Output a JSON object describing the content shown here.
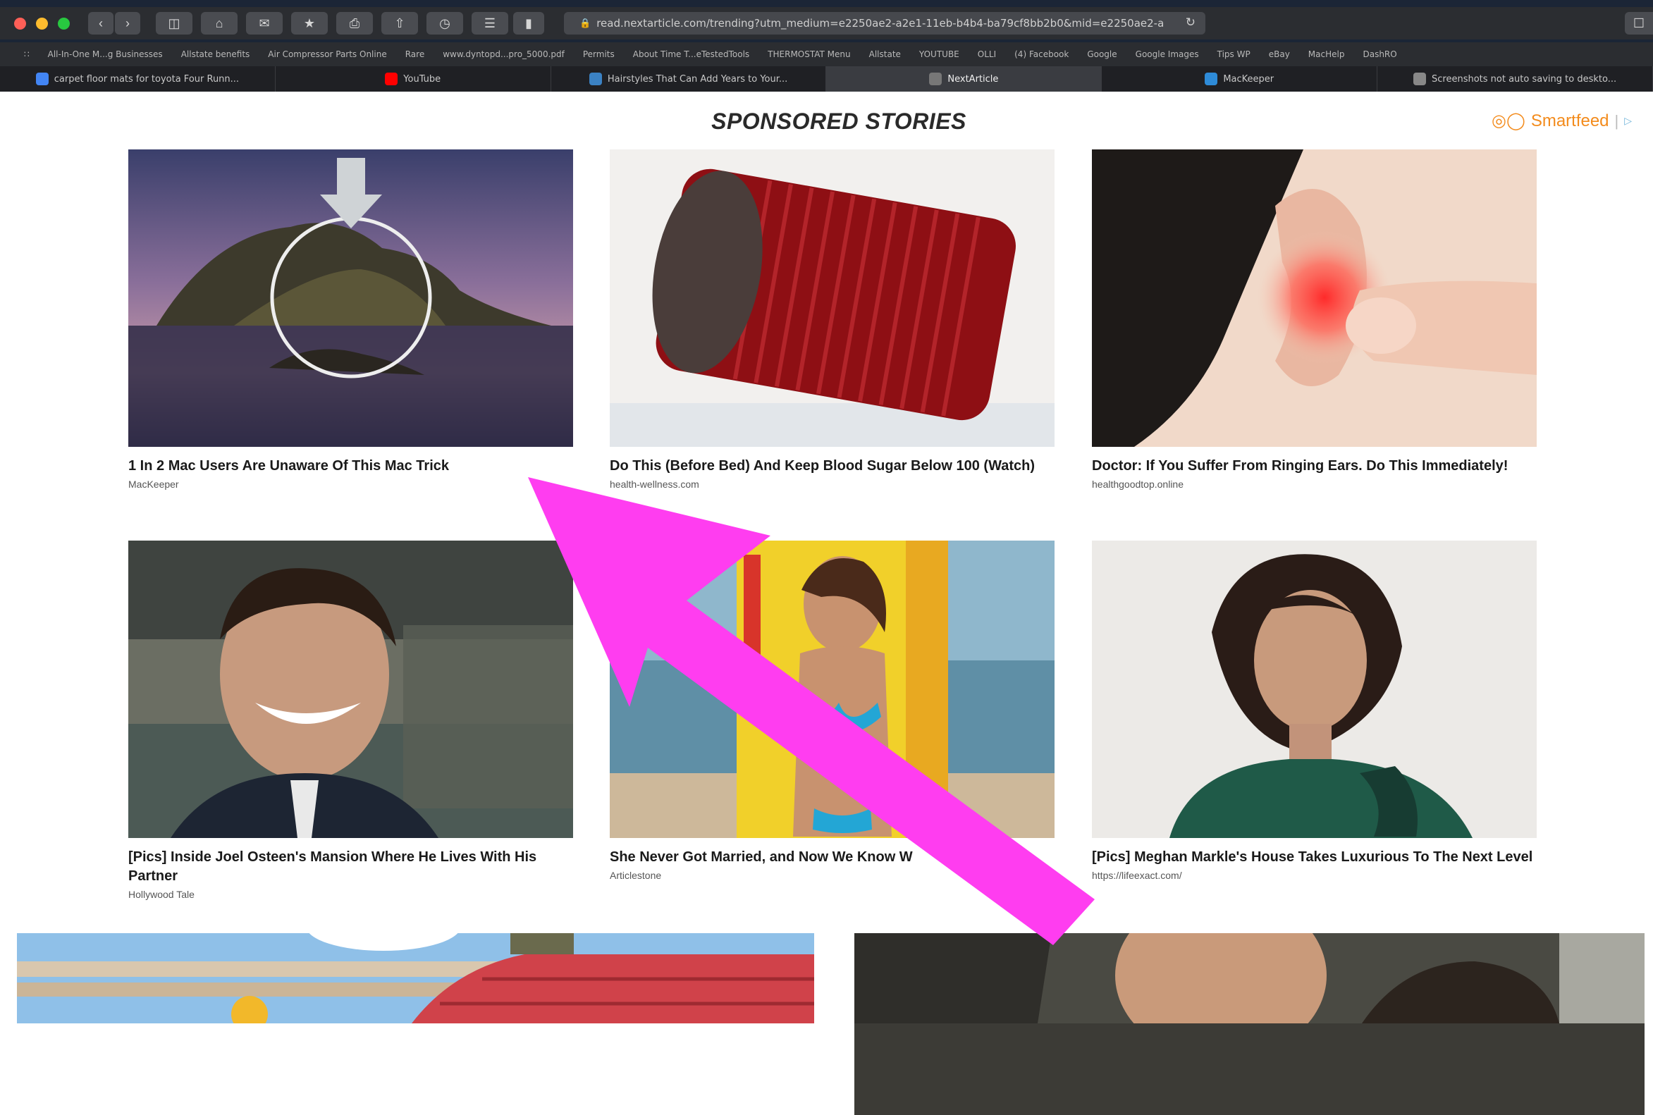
{
  "browser": {
    "url": "read.nextarticle.com/trending?utm_medium=e2250ae2-a2e1-11eb-b4b4-ba79cf8bb2b0&mid=e2250ae2-a",
    "bookmarks": [
      "All-In-One M...g Businesses",
      "Allstate benefits",
      "Air Compressor Parts Online",
      "Rare",
      "www.dyntopd...pro_5000.pdf",
      "Permits",
      "About Time T...eTestedTools",
      "THERMOSTAT Menu",
      "Allstate",
      "YOUTUBE",
      "OLLI",
      "(4) Facebook",
      "Google",
      "Google Images",
      "Tips WP",
      "eBay",
      "MacHelp",
      "DashRO"
    ],
    "tabs": [
      {
        "label": "carpet floor mats for toyota Four Runn...",
        "icon": "google-icon",
        "color": "#4285f4"
      },
      {
        "label": "YouTube",
        "icon": "youtube-icon",
        "color": "#ff0000"
      },
      {
        "label": "Hairstyles That Can Add Years to Your...",
        "icon": "f-icon",
        "color": "#3b82c4"
      },
      {
        "label": "NextArticle",
        "icon": "n-icon",
        "color": "#777777",
        "active": true
      },
      {
        "label": "MacKeeper",
        "icon": "mackeeper-icon",
        "color": "#2e8bd8"
      },
      {
        "label": "Screenshots not auto saving to deskto...",
        "icon": "apple-icon",
        "color": "#888888"
      }
    ]
  },
  "page": {
    "heading": "SPONSORED STORIES",
    "brand": "Smartfeed",
    "cards": [
      {
        "title": "1 In 2 Mac Users Are Unaware Of This Mac Trick",
        "source": "MacKeeper",
        "image": "island-mac-wallpaper"
      },
      {
        "title": "Do This (Before Bed) And Keep Blood Sugar Below 100 (Watch)",
        "source": "health-wellness.com",
        "image": "cranberry-jelly"
      },
      {
        "title": "Doctor: If You Suffer From Ringing Ears. Do This Immediately!",
        "source": "healthgoodtop.online",
        "image": "red-ear"
      },
      {
        "title": "[Pics] Inside Joel Osteen's Mansion Where He Lives With His Partner",
        "source": "Hollywood Tale",
        "image": "smiling-man"
      },
      {
        "title": "She Never Got Married, and Now We Know W",
        "source": "Articlestone",
        "image": "beach-woman"
      },
      {
        "title": "[Pics] Meghan Markle's House Takes Luxurious To The Next Level",
        "source": "https://lifeexact.com/",
        "image": "woman-portrait"
      }
    ],
    "bottom_cards": [
      {
        "image": "roof-worker"
      },
      {
        "image": "grey-haired-man"
      }
    ]
  },
  "annotation": {
    "type": "arrow",
    "color": "#ff3df0"
  }
}
